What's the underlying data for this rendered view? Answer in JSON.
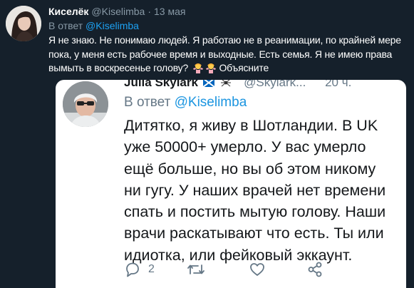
{
  "tweet": {
    "author_name": "Киселёк",
    "author_handle": "@Kiselimba",
    "separator": "·",
    "timestamp": "13 мая",
    "reply_prefix": "В ответ",
    "reply_mention": "@Kiselimba",
    "text": "Я не знаю. Не понимаю людей. Я работаю не в реанимации, по крайней мере пока, у меня есть рабочее время и выходные. Есть семья. Я не имею права вымыть в воскресенье голову?",
    "text_after_emoji": "Объясните",
    "emoji": [
      "woman-shrugging",
      "woman-shrugging"
    ]
  },
  "quoted": {
    "author_name": "Julia Skylark",
    "author_handle": "@Skylark...",
    "timestamp": "20 ч.",
    "badges": [
      "scottish-flag",
      "spider"
    ],
    "reply_prefix": "В ответ",
    "reply_mention": "@Kiselimba",
    "text": "Дитятко, я живу в Шотландии. В UK уже 50000+ умерло. У вас умерло ещё больше, но вы об этом никому ни гугу. У наших врачей нет времени спать и постить мытую голову. Наши врачи раскатывают что есть. Ты или идиотка, или фейковый эккаунт.",
    "actions": {
      "reply_count": "2",
      "retweet_count": "",
      "like_count": ""
    }
  },
  "colors": {
    "background": "#15202b",
    "secondary_text": "#8899a6",
    "accent": "#1da1f2",
    "quoted_background": "#ffffff",
    "quoted_text": "#14171a",
    "quoted_secondary": "#657786"
  }
}
